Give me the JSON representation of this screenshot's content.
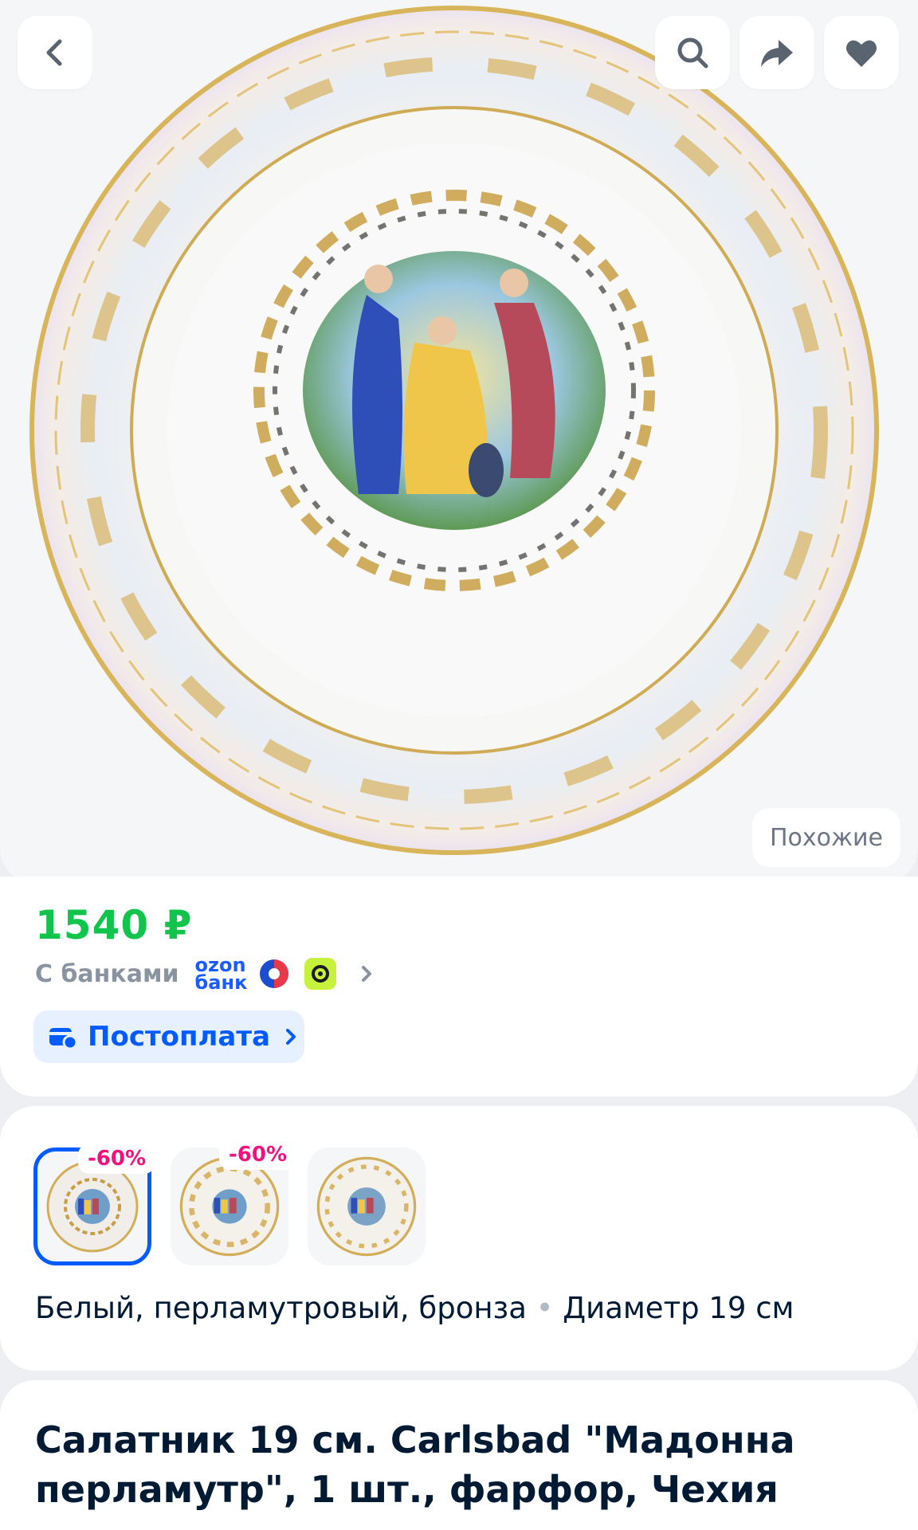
{
  "header": {
    "back_icon": "chevron-left-icon",
    "search_icon": "search-icon",
    "share_icon": "share-arrow-icon",
    "favorite_icon": "heart-icon"
  },
  "gallery": {
    "similar_label": "Похожие"
  },
  "price_block": {
    "price": "1540 ₽",
    "banks_label": "С банками",
    "ozon_bank_top": "ozon",
    "ozon_bank_bottom": "банк",
    "postpay_label": "Постоплата",
    "price_color": "#10c44c",
    "accent_color": "#005bff"
  },
  "variants": {
    "items": [
      {
        "discount": "-60%",
        "selected": true
      },
      {
        "discount": "-60%",
        "selected": false
      },
      {
        "discount": "",
        "selected": false
      }
    ],
    "color_text": "Белый, перламутровый, бронза",
    "separator": "•",
    "size_text": "Диаметр 19 см",
    "discount_color": "#f1117e"
  },
  "product": {
    "title": "Салатник 19 см. Carlsbad \"Мадонна перламутр\", 1 шт., фарфор, Чехия"
  }
}
